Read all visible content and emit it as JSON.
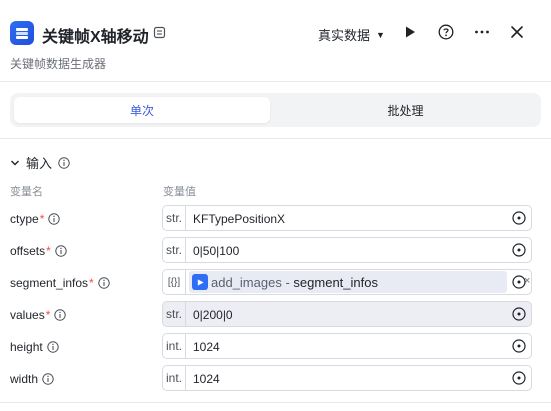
{
  "header": {
    "title": "关键帧X轴移动",
    "subtitle": "关键帧数据生成器",
    "mode_label": "真实数据",
    "accent_color": "#2f6df6"
  },
  "tabs": [
    {
      "label": "单次",
      "active": true
    },
    {
      "label": "批处理",
      "active": false
    }
  ],
  "section": {
    "title": "输入",
    "col_name": "变量名",
    "col_value": "变量值"
  },
  "params": [
    {
      "name": "ctype",
      "required": true,
      "type": "str.",
      "value": "KFTypePositionX"
    },
    {
      "name": "offsets",
      "required": true,
      "type": "str.",
      "value": "0|50|100"
    },
    {
      "name": "segment_infos",
      "required": true,
      "type": "[{}]",
      "ref_source": "add_images",
      "ref_sep": "-",
      "ref_field": "segment_infos"
    },
    {
      "name": "values",
      "required": true,
      "type": "str.",
      "value": "0|200|0"
    },
    {
      "name": "height",
      "required": false,
      "type": "int.",
      "value": "1024"
    },
    {
      "name": "width",
      "required": false,
      "type": "int.",
      "value": "1024"
    }
  ],
  "icons": {
    "app": "keyframe-app-icon",
    "badge": "snapshot-icon",
    "run": "play-icon",
    "help": "help-icon",
    "more": "more-icon",
    "close": "close-icon",
    "collapse": "chevron-down-icon",
    "info": "info-icon",
    "var_picker": "variable-picker-icon",
    "clear": "clear-icon"
  },
  "clear_glyph": "×"
}
